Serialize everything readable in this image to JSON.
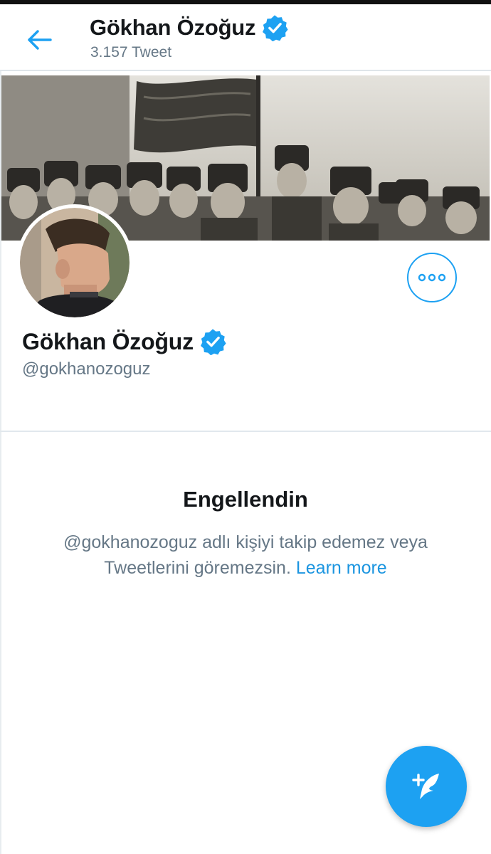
{
  "header": {
    "name": "Gökhan Özoğuz",
    "tweet_count": "3.157 Tweet",
    "back_icon": "arrow-left-icon",
    "verified_icon": "verified-badge-icon"
  },
  "profile": {
    "name": "Gökhan Özoğuz",
    "handle": "@gokhanozoguz",
    "more_icon": "more-options-icon"
  },
  "blocked": {
    "title": "Engellendin",
    "message": "@gokhanozoguz adlı kişiyi takip edemez veya Tweetlerini göremezsin.",
    "learn_more": "Learn more"
  },
  "compose": {
    "icon": "compose-tweet-icon"
  },
  "colors": {
    "accent": "#1da1f2",
    "text_primary": "#14171a",
    "text_secondary": "#657786",
    "link": "#1b95e0"
  }
}
